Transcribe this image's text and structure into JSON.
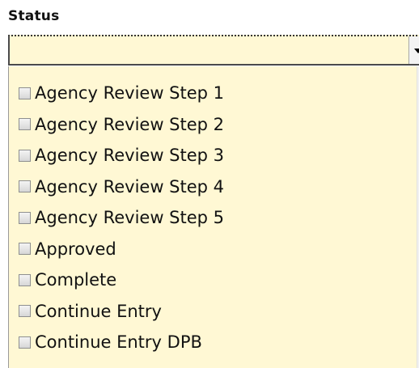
{
  "field": {
    "label": "Status",
    "value": ""
  },
  "dropdown": {
    "background_color": "#fff8d4",
    "items": [
      {
        "label": "Agency Review Step 1",
        "checked": false
      },
      {
        "label": "Agency Review Step 2",
        "checked": false
      },
      {
        "label": "Agency Review Step 3",
        "checked": false
      },
      {
        "label": "Agency Review Step 4",
        "checked": false
      },
      {
        "label": "Agency Review Step 5",
        "checked": false
      },
      {
        "label": "Approved",
        "checked": false
      },
      {
        "label": "Complete",
        "checked": false
      },
      {
        "label": "Continue Entry",
        "checked": false
      },
      {
        "label": "Continue Entry DPB",
        "checked": false
      }
    ]
  },
  "icons": {
    "combo_arrow": "chevron-down-icon",
    "scroll_up": "scroll-up-arrow-icon",
    "scroll_down": "scroll-down-arrow-icon"
  }
}
